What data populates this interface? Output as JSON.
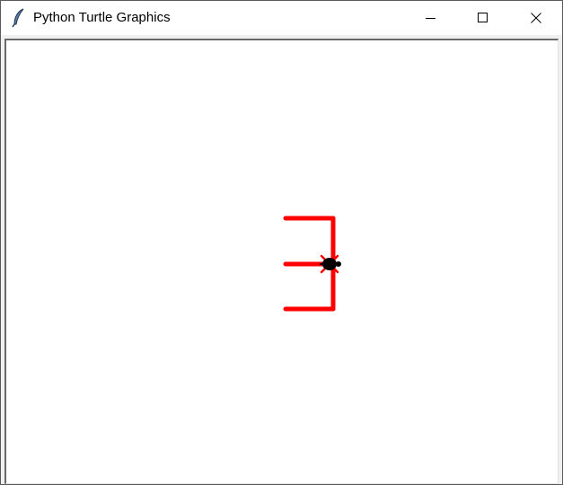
{
  "window": {
    "title": "Python Turtle Graphics",
    "app_icon": "feather-icon",
    "controls": {
      "minimize_icon": "minimize-icon",
      "maximize_icon": "maximize-icon",
      "close_icon": "close-icon"
    }
  },
  "canvas": {
    "background": "#ffffff",
    "pen_color": "#ff0000",
    "turtle_color": "#000000",
    "turtle_icon": "turtle-icon"
  }
}
